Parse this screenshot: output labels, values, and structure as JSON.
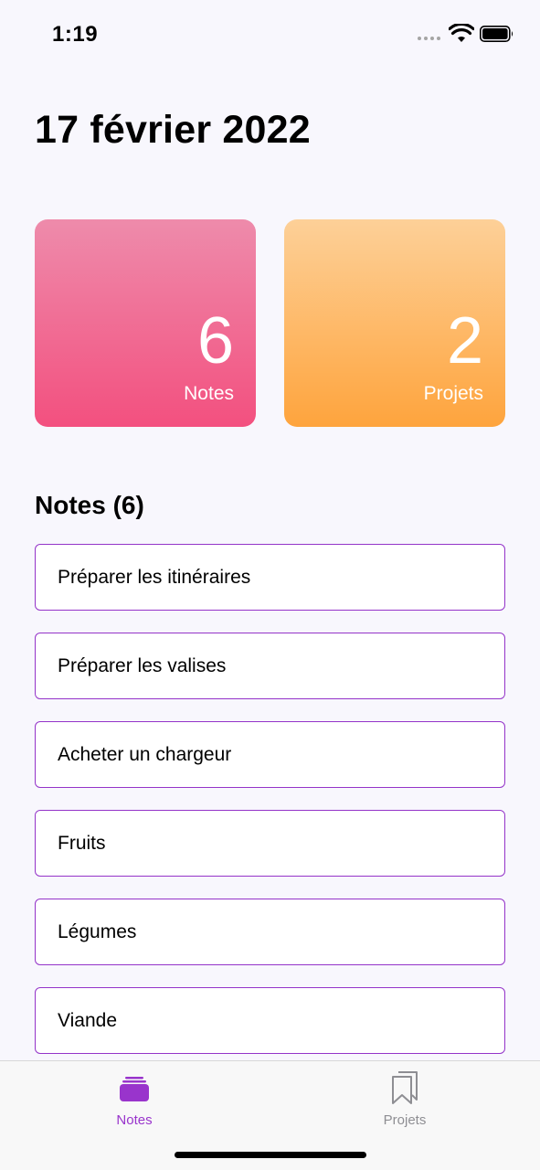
{
  "status_bar": {
    "time": "1:19"
  },
  "header": {
    "title": "17 février 2022"
  },
  "summary_cards": {
    "notes": {
      "count": "6",
      "label": "Notes",
      "gradient": [
        "#ee8bab",
        "#f3507f"
      ]
    },
    "projects": {
      "count": "2",
      "label": "Projets",
      "gradient": [
        "#fdd098",
        "#fea43d"
      ]
    }
  },
  "notes_section": {
    "title": "Notes (6)",
    "items": [
      "Préparer les itinéraires",
      "Préparer les valises",
      "Acheter un chargeur",
      "Fruits",
      "Légumes",
      "Viande"
    ]
  },
  "tab_bar": {
    "tabs": [
      {
        "label": "Notes",
        "icon": "stack-icon",
        "selected": true
      },
      {
        "label": "Projets",
        "icon": "bookmarks-icon",
        "selected": false
      }
    ]
  },
  "colors": {
    "accent": "#9934cc",
    "background": "#f8f7fd",
    "inactive_tab": "#8e8e93"
  }
}
